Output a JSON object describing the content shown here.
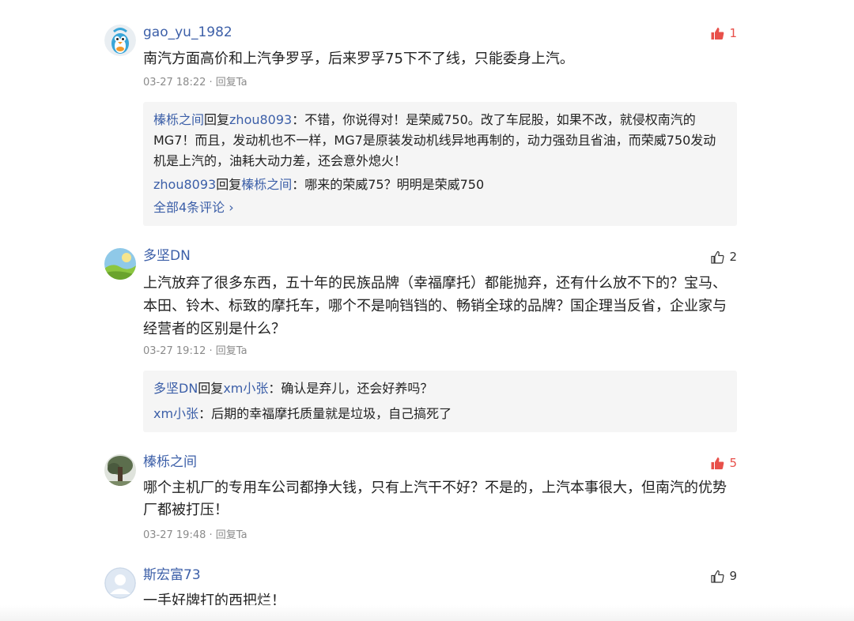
{
  "colors": {
    "username": "#3c5fa8",
    "liked": "#e8504a",
    "meta": "#8b8b8b",
    "reply_bg": "#f5f5f5"
  },
  "comments": [
    {
      "user": "gao_yu_1982",
      "avatar_icon": "penguin-avatar",
      "likes": "1",
      "liked": true,
      "text": "南汽方面高价和上汽争罗孚，后来罗孚75下不了线，只能委身上汽。",
      "time": "03-27 18:22",
      "sep": "·",
      "reply_label": "回复Ta",
      "replies": [
        {
          "from": "榛栎之间",
          "verb": "回复",
          "to": "zhou8093",
          "colon": "：",
          "text": "不错，你说得对！是荣威750。改了车屁股，如果不改，就侵权南汽的MG7！而且，发动机也不一样，MG7是原装发动机线异地再制的，动力强劲且省油，而荣威750发动机是上汽的，油耗大动力差，还会意外熄火！"
        },
        {
          "from": "zhou8093",
          "verb": "回复",
          "to": "榛栎之间",
          "colon": "：",
          "text": "哪来的荣威75？明明是荣威750"
        }
      ],
      "more_label": "全部4条评论 ›"
    },
    {
      "user": "多坚DN",
      "avatar_icon": "landscape-avatar",
      "likes": "2",
      "liked": false,
      "text": "上汽放弃了很多东西，五十年的民族品牌（幸福摩托）都能抛弃，还有什么放不下的？宝马、本田、铃木、标致的摩托车，哪个不是响铛铛的、畅销全球的品牌？国企理当反省，企业家与经营者的区别是什么？",
      "time": "03-27 19:12",
      "sep": "·",
      "reply_label": "回复Ta",
      "replies": [
        {
          "from": "多坚DN",
          "verb": "回复",
          "to": "xm小张",
          "colon": "：",
          "text": "确认是弃儿，还会好养吗？"
        },
        {
          "from": "xm小张",
          "verb": "",
          "to": "",
          "colon": "：",
          "text": "后期的幸福摩托质量就是垃圾，自己搞死了"
        }
      ]
    },
    {
      "user": "榛栎之间",
      "avatar_icon": "tree-avatar",
      "likes": "5",
      "liked": true,
      "text": "哪个主机厂的专用车公司都挣大钱，只有上汽干不好？不是的，上汽本事很大，但南汽的优势厂都被打压！",
      "time": "03-27 19:48",
      "sep": "·",
      "reply_label": "回复Ta"
    },
    {
      "user": "斯宏富73",
      "avatar_icon": "default-user-avatar",
      "likes": "9",
      "liked": false,
      "text": "一手好牌打的西把烂！"
    }
  ]
}
